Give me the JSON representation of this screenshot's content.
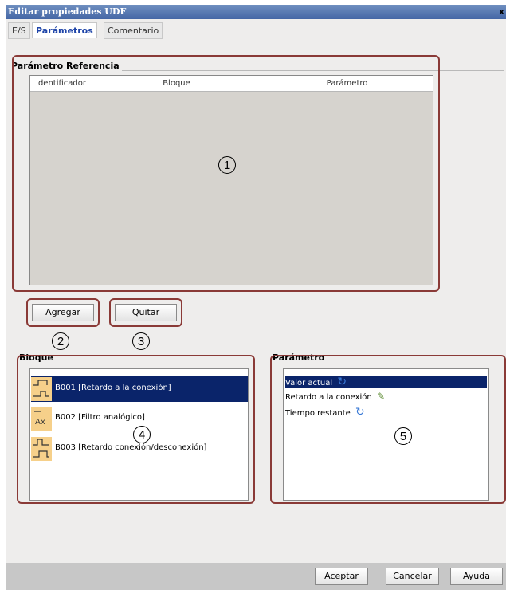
{
  "window": {
    "title": "Editar propiedades UDF",
    "close_label": "x"
  },
  "tabs": [
    {
      "label": "E/S",
      "active": false
    },
    {
      "label": "Parámetros",
      "active": true
    },
    {
      "label": "Comentario",
      "active": false
    }
  ],
  "ref_group": {
    "label": "Parámetro Referencia",
    "columns": [
      "Identificador",
      "Bloque",
      "Parámetro"
    ],
    "rows": []
  },
  "buttons": {
    "add": "Agregar",
    "remove": "Quitar"
  },
  "block_group": {
    "label": "Bloque",
    "items": [
      {
        "icon": "on-delay-icon",
        "label": "B001 [Retardo a la conexión]",
        "selected": true
      },
      {
        "icon": "analog-filter-icon",
        "icon_text": "Ax",
        "label": "B002 [Filtro analógico]",
        "selected": false
      },
      {
        "icon": "on-off-delay-icon",
        "label": "B003 [Retardo conexión/desconexión]",
        "selected": false
      }
    ]
  },
  "param_group": {
    "label": "Parámetro",
    "items": [
      {
        "label": "Valor actual",
        "icon": "refresh-icon",
        "selected": true
      },
      {
        "label": "Retardo a la conexión",
        "icon": "edit-icon",
        "selected": false
      },
      {
        "label": "Tiempo restante",
        "icon": "refresh-icon",
        "selected": false
      }
    ]
  },
  "callouts": [
    "1",
    "2",
    "3",
    "4",
    "5"
  ],
  "footer": {
    "ok": "Aceptar",
    "cancel": "Cancelar",
    "help": "Ayuda"
  },
  "colors": {
    "callout": "#8a3a37",
    "selection": "#0a246a",
    "active_tab": "#1e44a8",
    "icon_bg": "#f6d08a"
  }
}
